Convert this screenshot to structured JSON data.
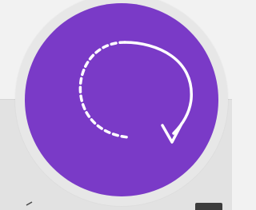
{
  "colors": {
    "background_top": "#f2f2f2",
    "background_bottom": "#e2e2e2",
    "ring": "#e7e7e7",
    "accent_purple": "#7a3ac7",
    "icon_white": "#ffffff",
    "dark_chip": "#3c3c3c"
  },
  "action_button": {
    "icon_name": "refresh-rotate-icon"
  },
  "bottom_bar": {
    "left_icon_name": "partial-icon",
    "right_icon_name": "partial-icon"
  }
}
